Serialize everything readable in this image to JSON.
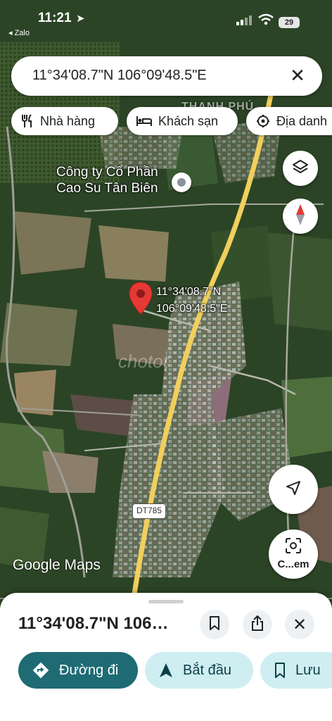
{
  "status_bar": {
    "time": "11:21",
    "back_app": "◂ Zalo",
    "battery": "29"
  },
  "search": {
    "query": "11°34'08.7\"N 106°09'48.5\"E",
    "clear_symbol": "✕"
  },
  "chips": [
    {
      "label": "Nhà hàng",
      "icon": "utensils-icon"
    },
    {
      "label": "Khách sạn",
      "icon": "bed-icon"
    },
    {
      "label": "Địa danh",
      "icon": "landmark-icon"
    }
  ],
  "map": {
    "poi_name_line1": "Công ty Cổ Phần",
    "poi_name_line2": "Cao Su Tân Biên",
    "town_label": "THANH PHÚ",
    "pin_coord_line1": "11°34'08.7\"N",
    "pin_coord_line2": "106°09'48.5\"E",
    "road_shield": "DT785",
    "attribution": "Google Maps",
    "lens_label": "C...em",
    "watermark": "chotot"
  },
  "sheet": {
    "title": "11°34'08.7\"N 106…",
    "close_symbol": "✕"
  },
  "actions": [
    {
      "label": "Đường đi",
      "icon": "directions-icon"
    },
    {
      "label": "Bắt đầu",
      "icon": "navigation-arrow-icon"
    },
    {
      "label": "Lưu",
      "icon": "bookmark-icon"
    }
  ],
  "colors": {
    "primary_action": "#1e6b73",
    "secondary_action": "#cfeef2",
    "pin": "#e53935",
    "road": "#f4d46b"
  }
}
